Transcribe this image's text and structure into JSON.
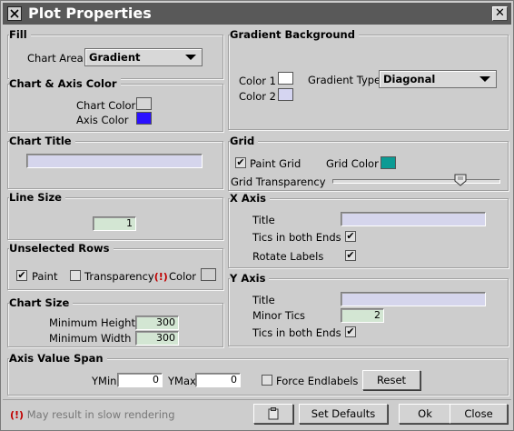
{
  "window": {
    "title": "Plot Properties",
    "close_glyph": "✕"
  },
  "fill": {
    "legend": "Fill",
    "chart_area_label": "Chart Area",
    "chart_area_value": "Gradient"
  },
  "gradient_bg": {
    "legend": "Gradient Background",
    "color1_label": "Color 1",
    "color2_label": "Color 2",
    "color1": "#ffffff",
    "color2": "#d5d5f1",
    "type_label": "Gradient Type",
    "type_value": "Diagonal"
  },
  "chart_axis_color": {
    "legend": "Chart & Axis Color",
    "chart_color_label": "Chart Color",
    "axis_color_label": "Axis Color",
    "chart_color": "#d6d6d6",
    "axis_color": "#2a10ff"
  },
  "chart_title": {
    "legend": "Chart Title",
    "value": ""
  },
  "grid": {
    "legend": "Grid",
    "paint_grid_label": "Paint Grid",
    "paint_grid_checked": true,
    "grid_color_label": "Grid Color",
    "grid_color": "#0b9b94",
    "transparency_label": "Grid Transparency",
    "transparency_fraction": 0.76
  },
  "line_size": {
    "legend": "Line Size",
    "value": "1"
  },
  "x_axis": {
    "legend": "X Axis",
    "title_label": "Title",
    "title_value": "",
    "tics_label": "Tics in both Ends",
    "tics_checked": true,
    "rotate_label": "Rotate Labels",
    "rotate_checked": true
  },
  "unselected_rows": {
    "legend": "Unselected Rows",
    "paint_label": "Paint",
    "paint_checked": true,
    "transparency_label": "Transparency",
    "transparency_checked": false,
    "warn_mark": "(!)",
    "color_label": "Color",
    "color": "#d0d0d0"
  },
  "y_axis": {
    "legend": "Y Axis",
    "title_label": "Title",
    "title_value": "",
    "minor_tics_label": "Minor Tics",
    "minor_tics_value": "2",
    "tics_label": "Tics in both Ends",
    "tics_checked": true
  },
  "chart_size": {
    "legend": "Chart Size",
    "min_height_label": "Minimum Height",
    "min_height_value": "300",
    "min_width_label": "Minimum Width",
    "min_width_value": "300"
  },
  "axis_span": {
    "legend": "Axis Value Span",
    "ymin_label": "YMin",
    "ymin_value": "0",
    "ymax_label": "YMax",
    "ymax_value": "0",
    "force_label": "Force Endlabels",
    "force_checked": false,
    "reset_label": "Reset"
  },
  "status": {
    "warn_mark": "(!)",
    "message": "May result in slow rendering"
  },
  "buttons": {
    "set_defaults": "Set Defaults",
    "ok": "Ok",
    "close": "Close"
  },
  "icons": {
    "app": "app-icon",
    "close": "close-icon",
    "clipboard": "clipboard-icon"
  },
  "check_glyph": "✔"
}
